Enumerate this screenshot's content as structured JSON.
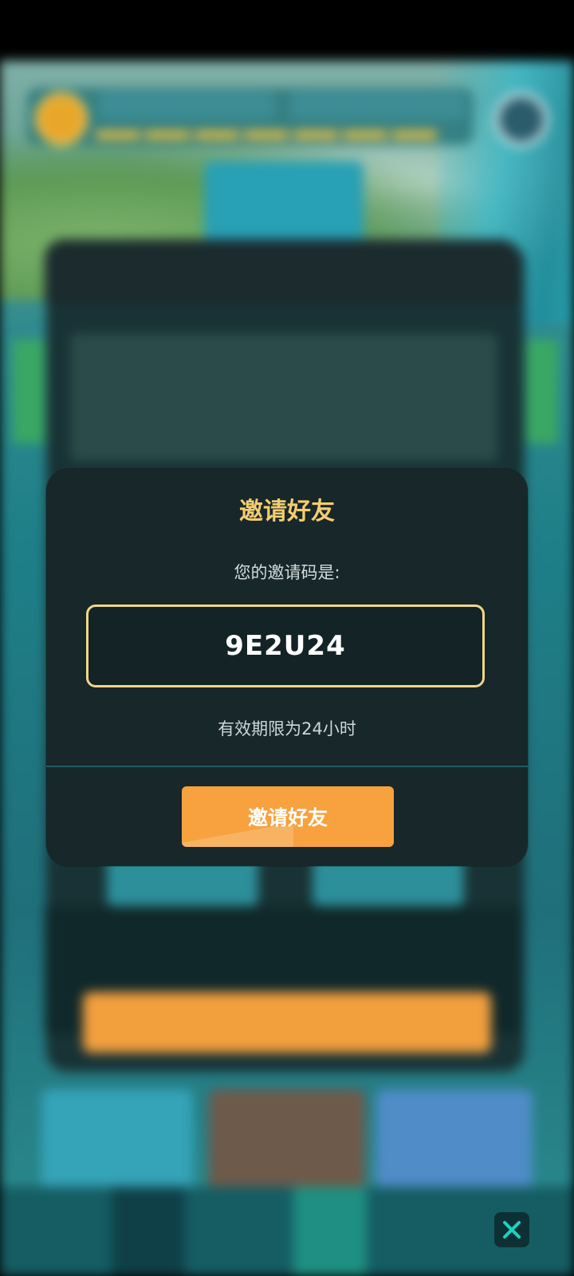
{
  "dialog": {
    "title": "邀请好友",
    "subtitle": "您的邀请码是:",
    "invite_code": "9E2U24",
    "validity": "有效期限为24小时",
    "invite_button_label": "邀请好友"
  },
  "icons": {
    "close": "close-icon"
  },
  "colors": {
    "accent_title": "#f5cd6f",
    "code_border": "#f0d68a",
    "button": "#f7a23f",
    "close_icon": "#19d3c0"
  }
}
